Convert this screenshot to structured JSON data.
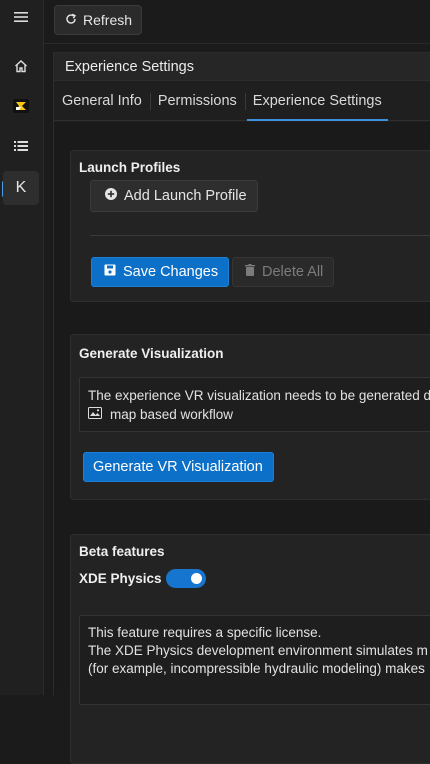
{
  "rail": {
    "items": [
      {
        "name": "menu-icon"
      },
      {
        "name": "home-icon"
      },
      {
        "name": "app-logo-icon"
      },
      {
        "name": "list-icon"
      },
      {
        "label": "K"
      }
    ]
  },
  "topbar": {
    "refresh_label": "Refresh"
  },
  "panel": {
    "title": "Experience Settings",
    "tabs": [
      {
        "label": "General Info"
      },
      {
        "label": "Permissions"
      },
      {
        "label": "Experience Settings",
        "active": true
      }
    ]
  },
  "launch_profiles": {
    "title": "Launch Profiles",
    "add_label": "Add Launch Profile",
    "save_label": "Save Changes",
    "delete_all_label": "Delete All"
  },
  "generate_visualization": {
    "title": "Generate Visualization",
    "info_line1": "The experience VR visualization needs to be generated d",
    "info_line2": "map based workflow",
    "button_label": "Generate VR Visualization"
  },
  "beta_features": {
    "title": "Beta features",
    "xde_physics_label": "XDE Physics",
    "xde_physics_enabled": true,
    "info_line1": "This feature requires a specific license.",
    "info_line2": "The XDE Physics development environment simulates m",
    "info_line3": "(for example, incompressible hydraulic modeling) makes"
  },
  "colors": {
    "accent": "#0d70c8",
    "tab_underline": "#3d8fe0",
    "toggle_on": "#1675cf"
  }
}
